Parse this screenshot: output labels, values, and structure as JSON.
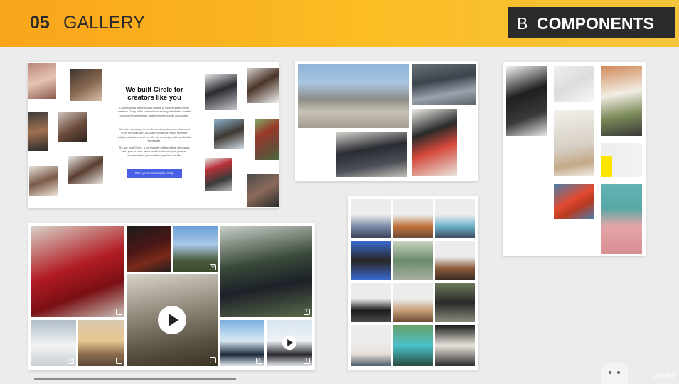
{
  "header": {
    "section_number": "05",
    "section_title": "GALLERY",
    "badge_letter": "B",
    "badge_label": "COMPONENTS"
  },
  "hero": {
    "title": "We built Circle for creators like you",
    "paragraphs": [
      "Communities are the chief lifeline of independent online creators. They build connections among members, enable profound experiences, and empower social advocates.",
      "But after speaking to hundreds of creators, we observed them struggle with co-called products, stitch together subpar solutions, and wrestle with mis-aligned brands that went stale.",
      "So, we built Circle: a community platform that integrates with your creator stack and transforms your passive audience into passionate superfans for life."
    ],
    "cta": "Start your community today"
  },
  "watermark": "Udemy",
  "colors": {
    "header": "#fbbd24",
    "badge": "#2b2b2b",
    "cta": "#4760e6"
  },
  "icons": [
    "play-icon",
    "facebook-icon",
    "instagram-icon"
  ]
}
